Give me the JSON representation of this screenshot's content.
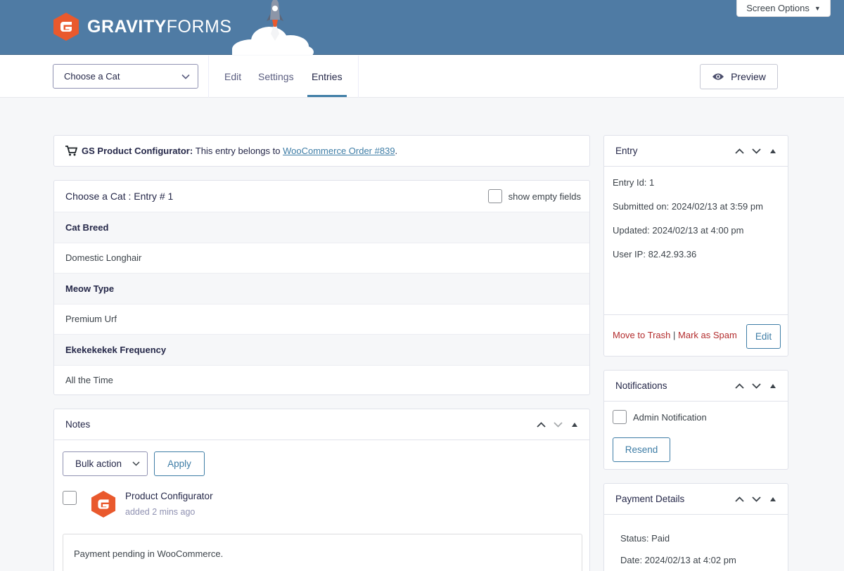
{
  "header": {
    "logo_bold": "GRAVITY",
    "logo_light": "FORMS",
    "screen_options": "Screen Options"
  },
  "toolbar": {
    "form_select_value": "Choose a Cat",
    "tabs": [
      {
        "label": "Edit"
      },
      {
        "label": "Settings"
      },
      {
        "label": "Entries"
      }
    ],
    "preview_label": "Preview"
  },
  "notice": {
    "title": "GS Product Configurator:",
    "text": "This entry belongs to",
    "link": "WooCommerce Order #839",
    "end": "."
  },
  "entry": {
    "title": "Choose a Cat : Entry # 1",
    "show_empty_label": "show empty fields",
    "fields": [
      {
        "label": "Cat Breed",
        "value": "Domestic Longhair"
      },
      {
        "label": "Meow Type",
        "value": "Premium Urf"
      },
      {
        "label": "Ekekekekek Frequency",
        "value": "All the Time"
      }
    ]
  },
  "notes": {
    "title": "Notes",
    "bulk_action": "Bulk action",
    "apply": "Apply",
    "author": "Product Configurator",
    "time": "added 2 mins ago",
    "text": "Payment pending in WooCommerce."
  },
  "side_entry": {
    "title": "Entry",
    "entry_id": "Entry Id: 1",
    "submitted": "Submitted on: 2024/02/13 at 3:59 pm",
    "updated": "Updated: 2024/02/13 at 4:00 pm",
    "ip": "User IP: 82.42.93.36",
    "trash": "Move to Trash",
    "separator": "|",
    "spam": "Mark as Spam",
    "edit": "Edit"
  },
  "notifications": {
    "title": "Notifications",
    "item": "Admin Notification",
    "resend": "Resend"
  },
  "payment": {
    "title": "Payment Details",
    "status": "Status: Paid",
    "date": "Date: 2024/02/13 at 4:02 pm"
  },
  "colors": {
    "header_bg": "#4f7ba4",
    "brand_orange": "#e9592d",
    "link_blue": "#3e7da6",
    "danger_red": "#b32d2e"
  }
}
